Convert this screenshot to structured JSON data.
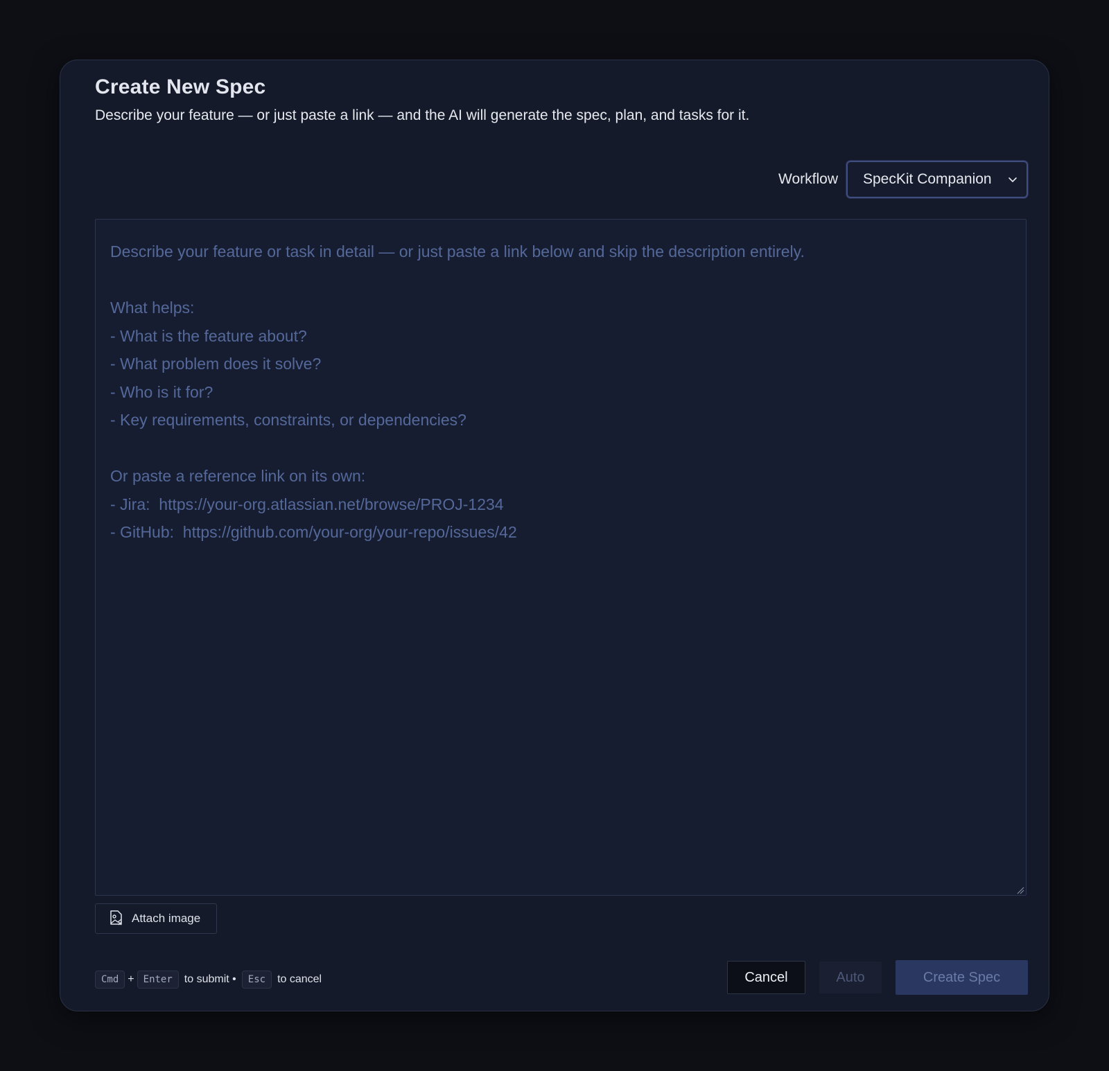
{
  "dialog": {
    "title": "Create New Spec",
    "subtitle": "Describe your feature — or just paste a link — and the AI will generate the spec, plan, and tasks for it."
  },
  "workflow": {
    "label": "Workflow",
    "selected": "SpecKit Companion",
    "icon": "chevron-down-icon"
  },
  "editor": {
    "placeholder_lines": [
      "Describe your feature or task in detail — or just paste a link below and skip the description entirely.",
      "",
      "What helps:",
      "- What is the feature about?",
      "- What problem does it solve?",
      "- Who is it for?",
      "- Key requirements, constraints, or dependencies?",
      "",
      "Or paste a reference link on its own:",
      "- Jira:  https://your-org.atlassian.net/browse/PROJ-1234",
      "- GitHub:  https://github.com/your-org/your-repo/issues/42"
    ]
  },
  "attach": {
    "label": "Attach image",
    "icon": "image-attach-icon"
  },
  "shortcuts": {
    "key_cmd": "Cmd",
    "plus": "+",
    "key_enter": "Enter",
    "submit_text": "to submit •",
    "key_esc": "Esc",
    "cancel_text": "to cancel"
  },
  "buttons": {
    "cancel": "Cancel",
    "auto": "Auto",
    "create": "Create Spec"
  },
  "colors": {
    "background": "#0e0f15",
    "dialog": "#141a29",
    "placeholder": "#54689a",
    "primary_disabled": "#2a3861"
  }
}
